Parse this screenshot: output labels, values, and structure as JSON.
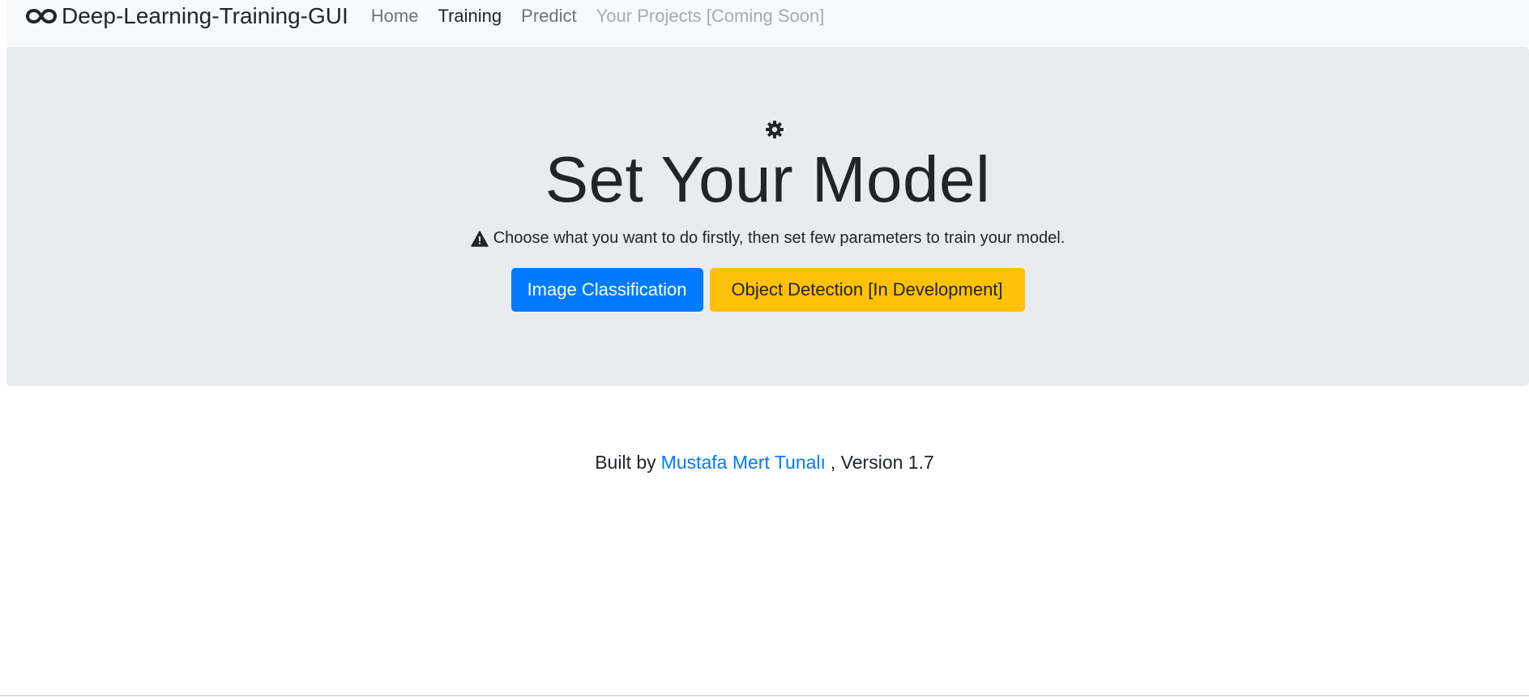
{
  "navbar": {
    "brand_icon": "infinity-icon",
    "brand": "Deep-Learning-Training-GUI",
    "links": [
      {
        "label": "Home",
        "state": "normal"
      },
      {
        "label": "Training",
        "state": "active"
      },
      {
        "label": "Predict",
        "state": "normal"
      },
      {
        "label": "Your Projects [Coming Soon]",
        "state": "disabled"
      }
    ]
  },
  "hero": {
    "icon": "gear-icon",
    "title": "Set Your Model",
    "lead_icon": "warning-icon",
    "lead": "Choose what you want to do firstly, then set few parameters to train your model.",
    "buttons": {
      "image_classification": "Image Classification",
      "object_detection": "Object Detection [In Development]"
    }
  },
  "footer": {
    "prefix": "Built by",
    "author": "Mustafa Mert Tunalı",
    "suffix": ", Version 1.7"
  },
  "colors": {
    "primary": "#007bff",
    "warning": "#ffc107",
    "jumbotron_bg": "#e9ecef",
    "navbar_bg": "#f8f9fa"
  }
}
